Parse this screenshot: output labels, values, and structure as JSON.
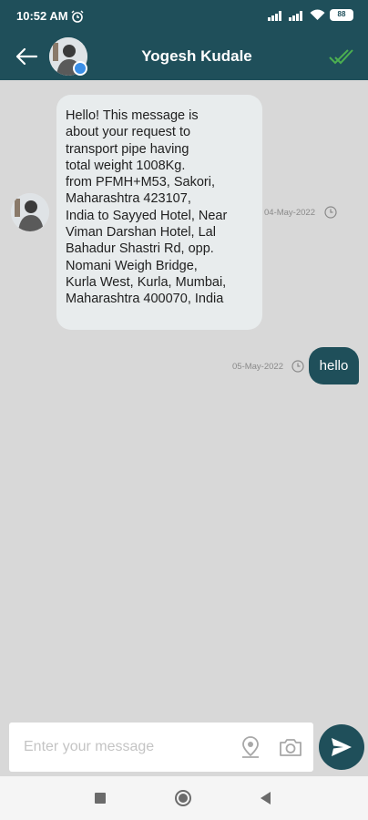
{
  "status_bar": {
    "time": "10:52 AM",
    "battery": "88",
    "icons": [
      "alarm-icon",
      "signal-icon",
      "signal-icon",
      "wifi-icon",
      "battery-icon"
    ]
  },
  "header": {
    "title": "Yogesh Kudale",
    "back_icon": "back-arrow-icon",
    "action_icon": "double-check-icon"
  },
  "messages": [
    {
      "direction": "incoming",
      "text": "Hello! This message is\nabout your request to\ntransport pipe having\ntotal weight 1008Kg.\nfrom PFMH+M53, Sakori,\nMaharashtra 423107,\nIndia  to Sayyed Hotel, Near\nViman Darshan Hotel, Lal\nBahadur Shastri Rd, opp.\nNomani Weigh Bridge,\nKurla West, Kurla, Mumbai,\nMaharashtra 400070, India",
      "timestamp": "04-May-2022"
    },
    {
      "direction": "outgoing",
      "text": "hello",
      "timestamp": "05-May-2022"
    }
  ],
  "composer": {
    "placeholder": "Enter your message",
    "icons": [
      "location-icon",
      "camera-icon",
      "send-icon"
    ]
  },
  "colors": {
    "primary": "#1f4f5a",
    "background": "#d8d8d8",
    "incoming_bubble": "#e8eced",
    "check": "#4caf50"
  }
}
